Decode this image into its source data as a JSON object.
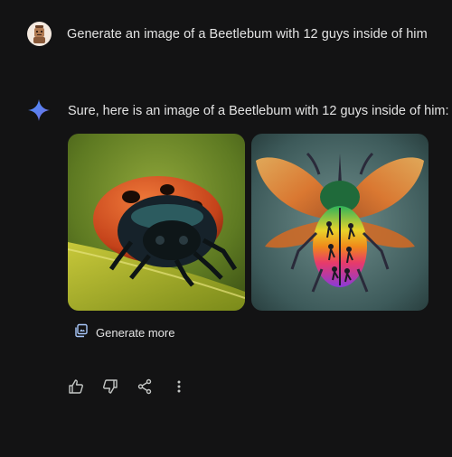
{
  "user": {
    "avatar_icon": "user-avatar-figure",
    "prompt": "Generate an image of a Beetlebum with 12 guys inside of him"
  },
  "response": {
    "icon": "gemini-sparkle-icon",
    "text": "Sure, here is an image of a Beetlebum with 12 guys inside of him:",
    "images": [
      {
        "subject": "red-black beetle on leaf"
      },
      {
        "subject": "rainbow winged beetle with silhouettes"
      }
    ],
    "generate_more_label": "Generate more"
  },
  "actions": [
    {
      "icon": "thumbs-up-icon"
    },
    {
      "icon": "thumbs-down-icon"
    },
    {
      "icon": "share-icon"
    },
    {
      "icon": "more-vert-icon"
    }
  ],
  "colors": {
    "background": "#131314",
    "text": "#e3e3e3",
    "accent": "#4285f4"
  }
}
